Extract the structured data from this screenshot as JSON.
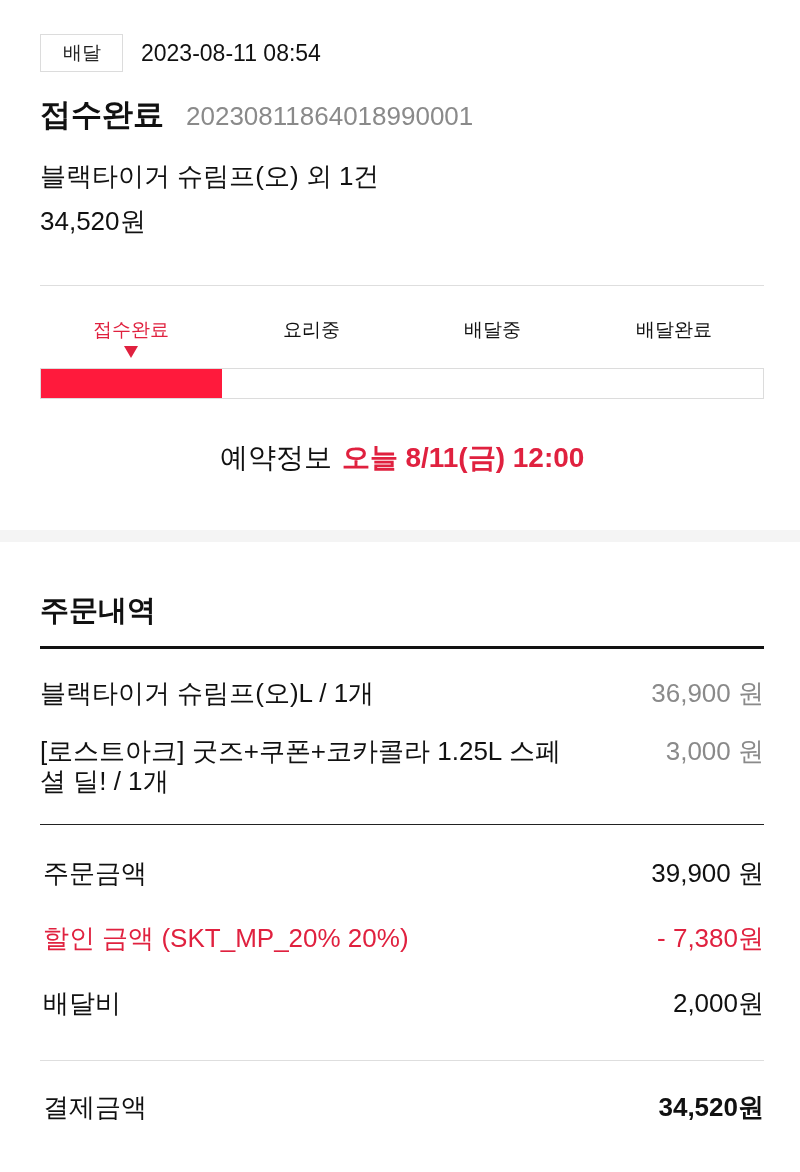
{
  "header": {
    "order_type": "배달",
    "datetime": "2023-08-11 08:54",
    "status": "접수완료",
    "order_number": "20230811864018990001",
    "summary": "블랙타이거 슈림프(오) 외 1건",
    "total": "34,520원"
  },
  "progress": {
    "steps": [
      {
        "label": "접수완료",
        "selected": true
      },
      {
        "label": "요리중",
        "selected": false
      },
      {
        "label": "배달중",
        "selected": false
      },
      {
        "label": "배달완료",
        "selected": false
      }
    ],
    "level": 0.25
  },
  "reservation": {
    "label": "예약정보",
    "value": "오늘 8/11(금) 12:00"
  },
  "order_details": {
    "title": "주문내역",
    "items": [
      {
        "name": "블랙타이거 슈림프(오)L / 1개",
        "price": "36,900 원"
      },
      {
        "name": "[로스트아크] 굿즈+쿠폰+코카콜라 1.25L 스페셜 딜! / 1개",
        "price": "3,000 원"
      }
    ],
    "charges": [
      {
        "kind": "normal",
        "label": "주문금액",
        "amount": "39,900 원"
      },
      {
        "kind": "discount",
        "label": "할인 금액 (SKT_MP_20% 20%)",
        "amount": "- 7,380원"
      },
      {
        "kind": "normal",
        "label": "배달비",
        "amount": "2,000원"
      }
    ],
    "payment": {
      "label": "결제금액",
      "amount": "34,520원"
    }
  }
}
